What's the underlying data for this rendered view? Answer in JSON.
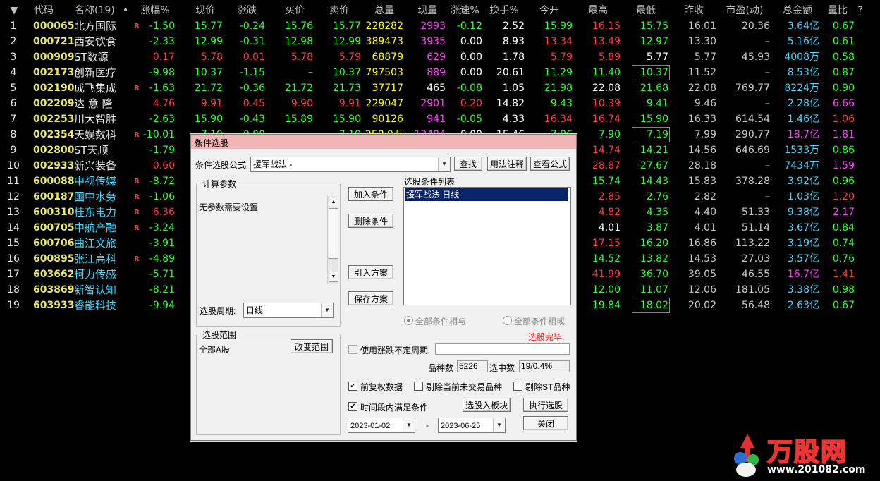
{
  "header": {
    "sort": "▼",
    "code": "代码",
    "name": "名称(19)",
    "dot": "•",
    "cols": [
      "涨幅%",
      "现价",
      "涨跌",
      "买价",
      "卖价",
      "总量",
      "现量",
      "涨速%",
      "换手%",
      "今开",
      "最高",
      "最低",
      "昨收",
      "市盈(动)",
      "总金额",
      "量比"
    ],
    "help": "?"
  },
  "colors": {
    "up": "#ff3b3b",
    "down": "#30ff30",
    "flat": "#ffffff",
    "code": "#e8e86a",
    "name": "#e8e8e8",
    "cyan": "#40d8ff",
    "magenta": "#ff40ff",
    "yellow": "#ffff00"
  },
  "rows": [
    {
      "idx": "1",
      "code": "000065",
      "name": "北方国际",
      "r": "R",
      "zf": "-1.50",
      "xj": "15.77",
      "zd": "-0.24",
      "mj": "15.76",
      "mcj": "15.77",
      "zl": "228282",
      "xl": "2993",
      "zs": "-0.12",
      "hs": "2.52",
      "jk": "15.99",
      "zg": "16.15",
      "zdi": "15.75",
      "zs2": "16.01",
      "syl": "20.36",
      "zje": "3.64",
      "zje_u": "亿",
      "lb": "0.67"
    },
    {
      "idx": "2",
      "code": "000721",
      "name": "西安饮食",
      "r": "",
      "zf": "-2.33",
      "xj": "12.99",
      "zd": "-0.31",
      "mj": "12.98",
      "mcj": "12.99",
      "zl": "389473",
      "xl": "3935",
      "zs": "0.00",
      "hs": "8.93",
      "jk": "13.34",
      "zg": "13.49",
      "zdi": "12.97",
      "zs2": "13.30",
      "syl": "–",
      "zje": "5.16",
      "zje_u": "亿",
      "lb": "0.61"
    },
    {
      "idx": "3",
      "code": "000909",
      "name": "ST数源",
      "r": "",
      "zf": "0.17",
      "xj": "5.78",
      "zd": "0.01",
      "mj": "5.78",
      "mcj": "5.79",
      "zl": "68879",
      "xl": "629",
      "zs": "0.00",
      "hs": "1.78",
      "jk": "5.79",
      "zg": "5.89",
      "zdi": "5.77",
      "zs2": "5.77",
      "syl": "45.93",
      "zje": "4008",
      "zje_u": "万",
      "lb": "0.58"
    },
    {
      "idx": "4",
      "code": "002173",
      "name": "创新医疗",
      "r": "",
      "zf": "-9.98",
      "xj": "10.37",
      "zd": "-1.15",
      "mj": "–",
      "mcj": "10.37",
      "zl": "797503",
      "xl": "889",
      "zs": "0.00",
      "hs": "20.61",
      "jk": "11.29",
      "zg": "11.40",
      "zdi": "10.37",
      "zs2": "11.52",
      "syl": "–",
      "zje": "8.53",
      "zje_u": "亿",
      "lb": "0.87"
    },
    {
      "idx": "5",
      "code": "002190",
      "name": "成飞集成",
      "r": "R",
      "zf": "-1.63",
      "xj": "21.72",
      "zd": "-0.36",
      "mj": "21.72",
      "mcj": "21.73",
      "zl": "37717",
      "xl": "465",
      "zs": "-0.08",
      "hs": "1.05",
      "jk": "21.98",
      "zg": "22.08",
      "zdi": "21.68",
      "zs2": "22.08",
      "syl": "769.77",
      "zje": "8224",
      "zje_u": "万",
      "lb": "0.90"
    },
    {
      "idx": "6",
      "code": "002209",
      "name": "达 意 隆",
      "r": "",
      "zf": "4.76",
      "xj": "9.91",
      "zd": "0.45",
      "mj": "9.90",
      "mcj": "9.91",
      "zl": "229047",
      "xl": "2901",
      "zs": "0.20",
      "hs": "14.82",
      "jk": "9.43",
      "zg": "10.39",
      "zdi": "9.41",
      "zs2": "9.46",
      "syl": "–",
      "zje": "2.28",
      "zje_u": "亿",
      "lb": "6.66"
    },
    {
      "idx": "7",
      "code": "002253",
      "name": "川大智胜",
      "r": "",
      "zf": "-2.63",
      "xj": "15.90",
      "zd": "-0.43",
      "mj": "15.89",
      "mcj": "15.90",
      "zl": "90126",
      "xl": "941",
      "zs": "-0.05",
      "hs": "4.33",
      "jk": "16.34",
      "zg": "16.74",
      "zdi": "15.90",
      "zs2": "16.33",
      "syl": "614.54",
      "zje": "1.46",
      "zje_u": "亿",
      "lb": "1.06"
    },
    {
      "idx": "8",
      "code": "002354",
      "name": "天娱数科",
      "r": "R",
      "zf": "-10.01",
      "xj": "7.19",
      "zd": "-0.80",
      "mj": "",
      "mcj": "7.19",
      "zl": "258.9万",
      "xl": "13484",
      "zs": "0.00",
      "hs": "15.46",
      "jk": "7.86",
      "zg": "7.90",
      "zdi": "7.19",
      "zs2": "7.99",
      "syl": "290.77",
      "zje": "18.7",
      "zje_u": "亿",
      "lb": "1.81"
    },
    {
      "idx": "9",
      "code": "002800",
      "name": "ST天顺",
      "r": "",
      "zf": "-1.79",
      "zg": "14.74",
      "zdi": "14.21",
      "zs2": "14.56",
      "syl": "646.69",
      "zje": "1533",
      "zje_u": "万",
      "lb": "0.86"
    },
    {
      "idx": "10",
      "code": "002933",
      "name": "新兴装备",
      "r": "",
      "zf": "0.60",
      "zg": "28.87",
      "zdi": "27.67",
      "zs2": "28.18",
      "syl": "–",
      "zje": "7434",
      "zje_u": "万",
      "lb": "1.59"
    },
    {
      "idx": "11",
      "code": "600088",
      "name": "中视传媒",
      "r": "R",
      "zf": "-8.72",
      "zg": "15.74",
      "zdi": "14.43",
      "zs2": "15.83",
      "syl": "378.28",
      "zje": "3.92",
      "zje_u": "亿",
      "lb": "0.96"
    },
    {
      "idx": "12",
      "code": "600187",
      "name": "国中水务",
      "r": "R",
      "zf": "-1.06",
      "zg": "2.85",
      "zdi": "2.76",
      "zs2": "2.82",
      "syl": "–",
      "zje": "1.03",
      "zje_u": "亿",
      "lb": "1.20"
    },
    {
      "idx": "13",
      "code": "600310",
      "name": "桂东电力",
      "r": "R",
      "zf": "6.36",
      "zg": "4.82",
      "zdi": "4.35",
      "zs2": "4.40",
      "syl": "51.33",
      "zje": "9.38",
      "zje_u": "亿",
      "lb": "2.17"
    },
    {
      "idx": "14",
      "code": "600705",
      "name": "中航产融",
      "r": "R",
      "zf": "-3.24",
      "zg": "4.01",
      "zdi": "3.87",
      "zs2": "4.01",
      "syl": "51.14",
      "zje": "3.67",
      "zje_u": "亿",
      "lb": "0.84"
    },
    {
      "idx": "15",
      "code": "600706",
      "name": "曲江文旅",
      "r": "",
      "zf": "-3.91",
      "zg": "17.15",
      "zdi": "16.20",
      "zs2": "16.86",
      "syl": "113.22",
      "zje": "3.19",
      "zje_u": "亿",
      "lb": "0.74"
    },
    {
      "idx": "16",
      "code": "600895",
      "name": "张江高科",
      "r": "R",
      "zf": "-4.89",
      "zg": "14.52",
      "zdi": "13.82",
      "zs2": "14.53",
      "syl": "27.03",
      "zje": "3.57",
      "zje_u": "亿",
      "lb": "0.76"
    },
    {
      "idx": "17",
      "code": "603662",
      "name": "柯力传感",
      "r": "",
      "zf": "-5.71",
      "zg": "41.99",
      "zdi": "36.70",
      "zs2": "39.05",
      "syl": "46.55",
      "zje": "16.7",
      "zje_u": "亿",
      "lb": "1.41"
    },
    {
      "idx": "18",
      "code": "603869",
      "name": "新智认知",
      "r": "",
      "zf": "-8.21",
      "zg": "12.00",
      "zdi": "11.07",
      "zs2": "12.06",
      "syl": "181.05",
      "zje": "3.38",
      "zje_u": "亿",
      "lb": "0.98"
    },
    {
      "idx": "19",
      "code": "603933",
      "name": "睿能科技",
      "r": "",
      "zf": "-9.94",
      "zg": "19.84",
      "zdi": "18.02",
      "zs2": "20.02",
      "syl": "56.48",
      "zje": "2.63",
      "zje_u": "亿",
      "lb": "0.67"
    }
  ],
  "dialog": {
    "title": "条件选股",
    "close": "✕",
    "formula_label": "条件选股公式",
    "formula_value": "援军战法  -",
    "btn_find": "查找",
    "btn_usage": "用法注释",
    "btn_view": "查看公式",
    "calc_params": "计算参数",
    "no_params": "无参数需要设置",
    "btn_add": "加入条件",
    "btn_delete": "删除条件",
    "btn_import": "引入方案",
    "btn_save": "保存方案",
    "cond_list_label": "选股条件列表",
    "cond_item": "援军战法  日线",
    "period_label": "选股周期:",
    "period_value": "日线",
    "radio_and": "全部条件相与",
    "radio_or": "全部条件相或",
    "status": "选股完毕.",
    "range_label": "选股范围",
    "range_value": "全部A股",
    "btn_change_range": "改变范围",
    "use_cycle": "使用涨跌不定周期",
    "count_label": "品种数",
    "count_value": "5226",
    "selected_label": "选中数",
    "selected_value": "19/0.4%",
    "chk_adjust": "前复权数据",
    "chk_no_trade": "剔除当前未交易品种",
    "chk_st": "剔除ST品种",
    "chk_period": "时间段内满足条件",
    "btn_to_block": "选股入板块",
    "btn_execute": "执行选股",
    "date_from": "2023-01-02",
    "date_dash": "-",
    "date_to": "2023-06-25",
    "btn_close": "关闭"
  },
  "logo": {
    "text": "万股网",
    "url": "www.201082.com"
  }
}
